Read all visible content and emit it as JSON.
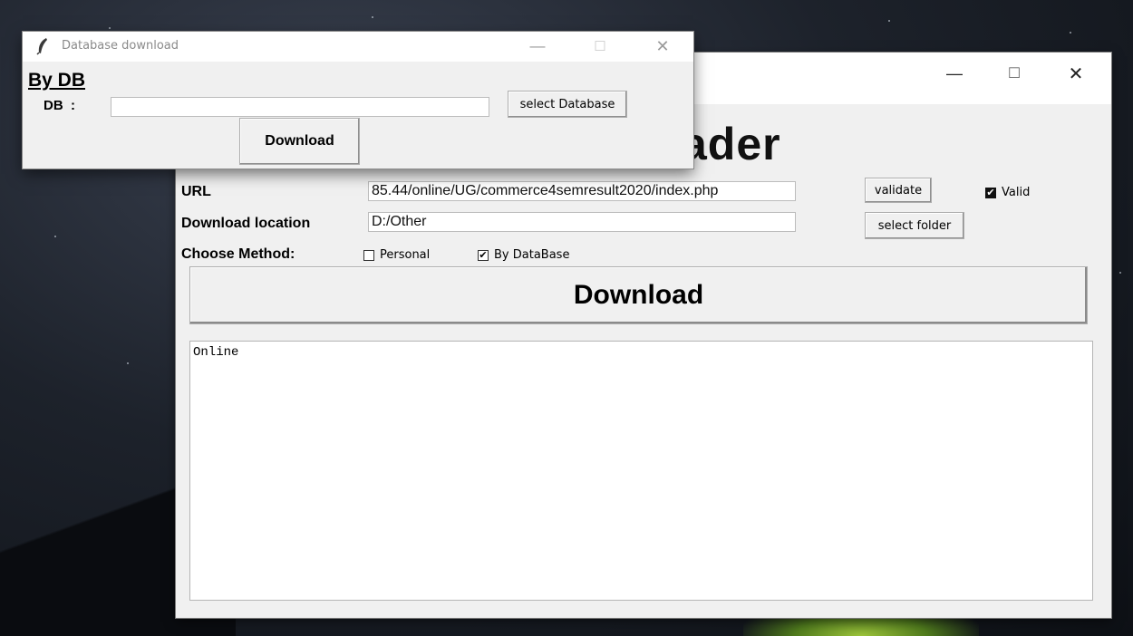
{
  "popup": {
    "title": "Database download",
    "heading": "By DB",
    "db_label": "DB  :",
    "db_value": "",
    "select_db_label": "select Database",
    "download_label": "Download",
    "controls": {
      "minimize": "—",
      "maximize": "☐",
      "close": "✕"
    }
  },
  "main": {
    "controls": {
      "minimize": "—",
      "maximize": "☐",
      "close": "✕"
    },
    "title_partial": "ader",
    "url_label": "URL",
    "url_value": "85.44/online/UG/commerce4semresult2020/index.php",
    "validate_label": "validate",
    "valid_label": "Valid",
    "valid_checked": true,
    "download_location_label": "Download location",
    "download_location_value": "D:/Other",
    "select_folder_label": "select folder",
    "choose_method_label": "Choose Method:",
    "method_personal_label": "Personal",
    "method_personal_checked": false,
    "method_bydb_label": "By DataBase",
    "method_bydb_checked": true,
    "download_label": "Download",
    "log_text": "Online"
  }
}
